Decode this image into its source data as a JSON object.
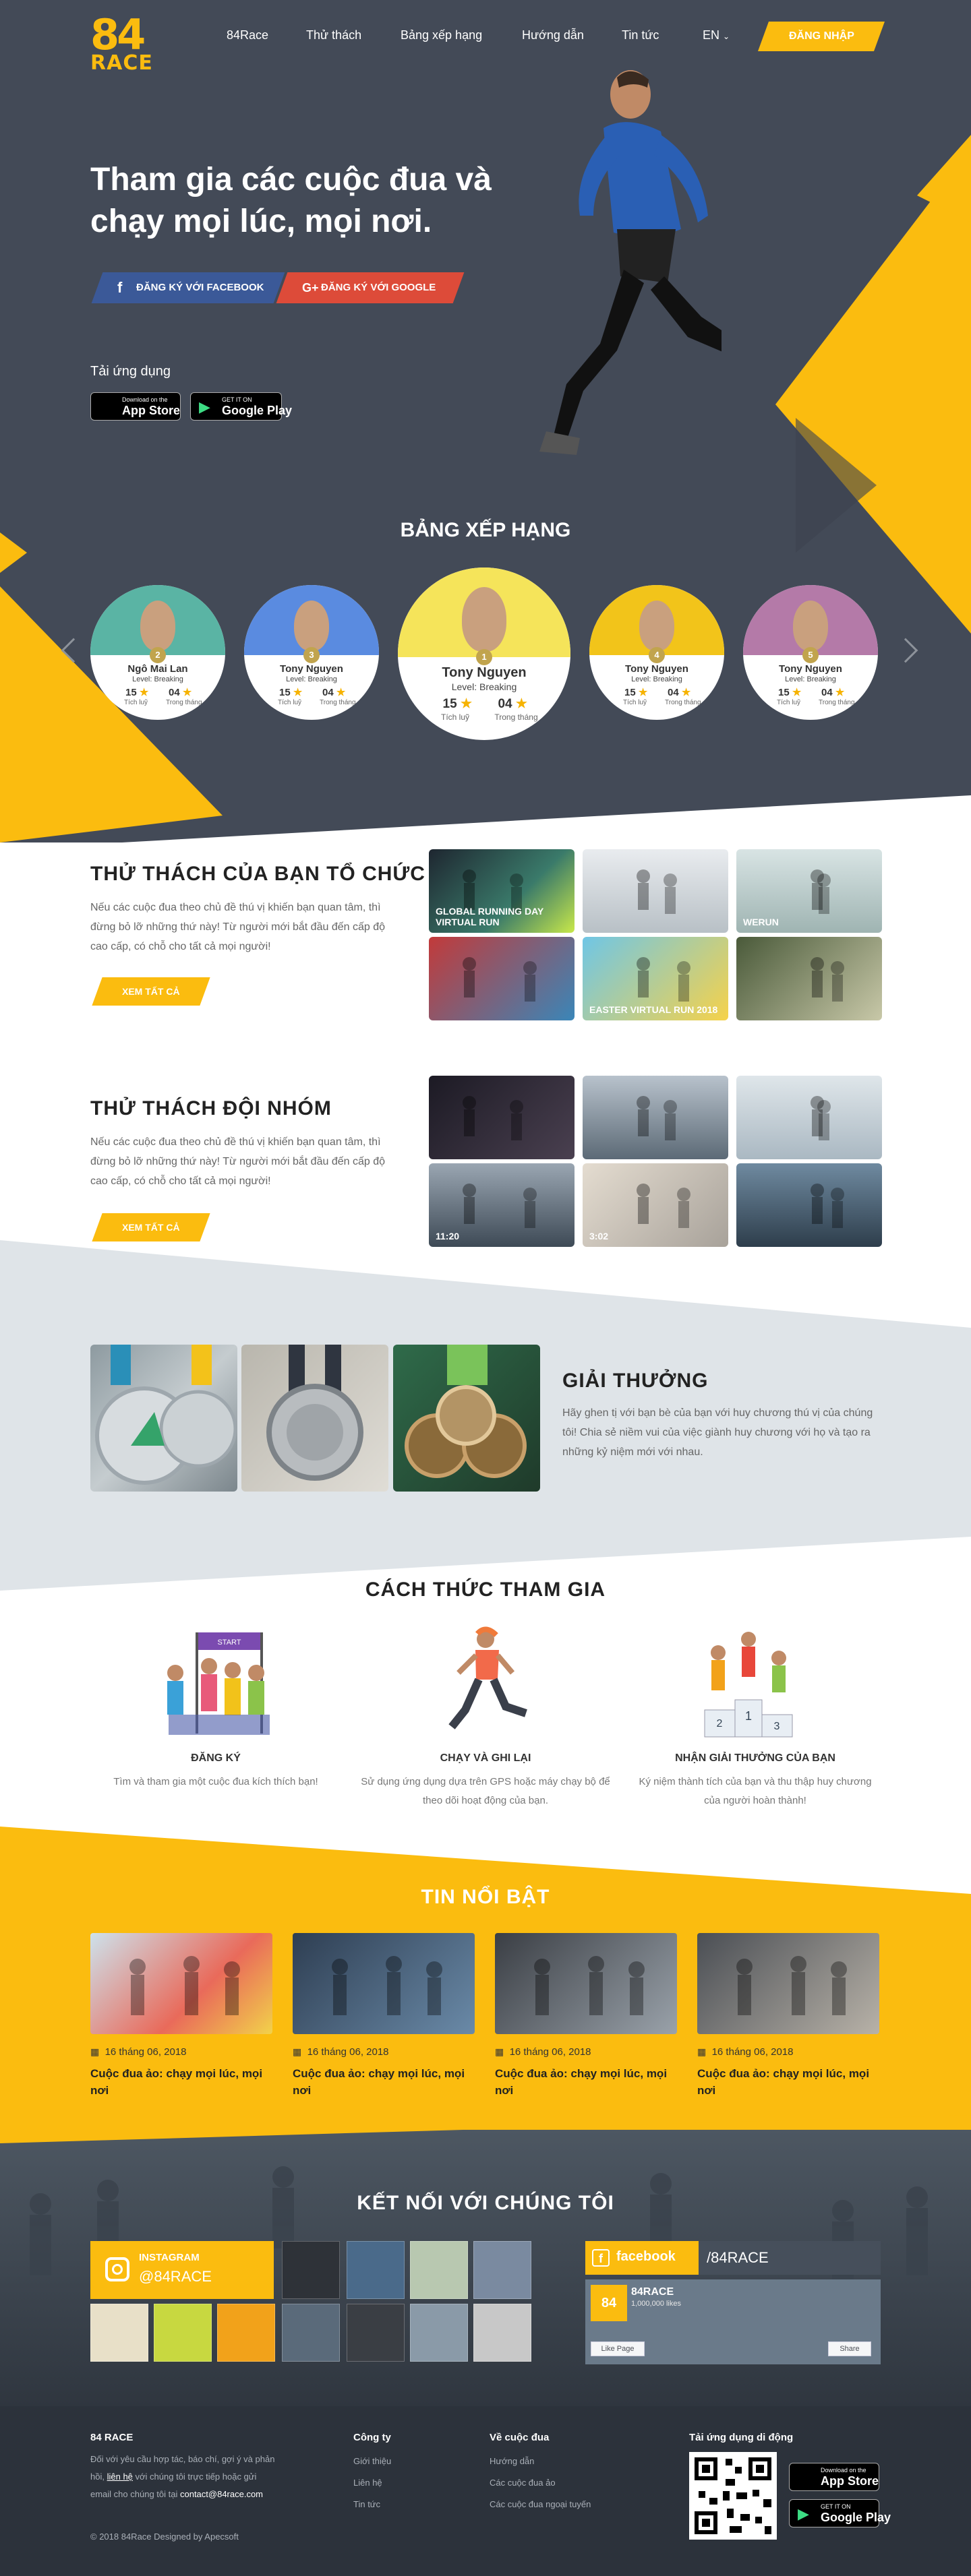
{
  "brand": {
    "logo_number": "84",
    "logo_word": "RACE"
  },
  "nav": {
    "items": [
      "84Race",
      "Thử thách",
      "Bảng xếp hạng",
      "Hướng dẫn",
      "Tin tức"
    ],
    "lang": "EN",
    "login": "ĐĂNG NHẬP"
  },
  "hero": {
    "title": "Tham gia các cuộc đua và chạy mọi lúc, mọi nơi.",
    "facebook_btn": "ĐĂNG KÝ VỚI FACEBOOK",
    "google_btn": "ĐĂNG KÝ VỚI GOOGLE",
    "apps_label": "Tải ứng dụng",
    "appstore_small": "Download on the",
    "appstore_big": "App Store",
    "googleplay_small": "GET IT ON",
    "googleplay_big": "Google Play"
  },
  "leaderboard": {
    "title": "BẢNG XẾP HẠNG",
    "cards": [
      {
        "rank": "2",
        "name": "Ngô Mai Lan",
        "level": "Level: Breaking",
        "total": "15",
        "month": "04",
        "total_label": "Tích luỹ",
        "month_label": "Trong tháng",
        "bg": "#5ab4a4"
      },
      {
        "rank": "3",
        "name": "Tony Nguyen",
        "level": "Level: Breaking",
        "total": "15",
        "month": "04",
        "total_label": "Tích luỹ",
        "month_label": "Trong tháng",
        "bg": "#5a8be0"
      },
      {
        "rank": "1",
        "name": "Tony Nguyen",
        "level": "Level: Breaking",
        "total": "15",
        "month": "04",
        "total_label": "Tích luỹ",
        "month_label": "Trong tháng",
        "bg": "#f5e45a"
      },
      {
        "rank": "4",
        "name": "Tony Nguyen",
        "level": "Level: Breaking",
        "total": "15",
        "month": "04",
        "total_label": "Tích luỹ",
        "month_label": "Trong tháng",
        "bg": "#f2c41a"
      },
      {
        "rank": "5",
        "name": "Tony Nguyen",
        "level": "Level: Breaking",
        "total": "15",
        "month": "04",
        "total_label": "Tích luỹ",
        "month_label": "Trong tháng",
        "bg": "#b47aa8"
      }
    ]
  },
  "organizer": {
    "title": "THỬ THÁCH CỦA BẠN TỔ CHỨC",
    "desc": "Nếu các cuộc đua theo chủ đề thú vị khiến bạn quan tâm, thì đừng bỏ lỡ những thứ này! Từ người mới bắt đầu đến cấp độ cao cấp, có chỗ cho tất cả mọi người!",
    "see_all": "XEM TẤT CẢ",
    "thumb_caps": [
      "GLOBAL RUNNING DAY VIRTUAL RUN",
      "",
      "WERUN",
      "",
      "EASTER VIRTUAL RUN 2018",
      ""
    ]
  },
  "team": {
    "title": "THỬ THÁCH ĐỘI NHÓM",
    "desc": "Nếu các cuộc đua theo chủ đề thú vị khiến bạn quan tâm, thì đừng bỏ lỡ những thứ này! Từ người mới bắt đầu đến cấp độ cao cấp, có chỗ cho tất cả mọi người!",
    "see_all": "XEM TẤT CẢ",
    "thumb_caps": [
      "",
      "",
      "",
      "11:20",
      "3:02",
      ""
    ]
  },
  "awards": {
    "title": "GIẢI THƯỞNG",
    "desc": "Hãy ghen tị với bạn bè của bạn với huy chương thú vị của chúng tôi! Chia sẻ niềm vui của việc giành huy chương với họ và tạo ra những kỷ niệm mới với nhau."
  },
  "how": {
    "title": "CÁCH THỨC THAM GIA",
    "steps": [
      {
        "title": "ĐĂNG KÝ",
        "desc": "Tìm và tham gia một cuộc đua kích thích bạn!",
        "sign": "START"
      },
      {
        "title": "CHẠY VÀ GHI LẠI",
        "desc": "Sử dụng ứng dụng dựa trên GPS hoặc máy chạy bộ để theo dõi hoạt động của bạn."
      },
      {
        "title": "NHẬN GIẢI THƯỞNG CỦA BẠN",
        "desc": "Ký niệm thành tích của bạn và thu thập huy chương của người hoàn thành!"
      }
    ]
  },
  "news": {
    "title": "TIN NỔI BẬT",
    "items": [
      {
        "date": "16 tháng 06, 2018",
        "title": "Cuộc đua ảo: chạy mọi lúc, mọi nơi"
      },
      {
        "date": "16 tháng 06, 2018",
        "title": "Cuộc đua ảo: chạy mọi lúc, mọi nơi"
      },
      {
        "date": "16 tháng 06, 2018",
        "title": "Cuộc đua ảo: chạy mọi lúc, mọi nơi"
      },
      {
        "date": "16 tháng 06, 2018",
        "title": "Cuộc đua ảo: chạy mọi lúc, mọi nơi"
      }
    ]
  },
  "connect": {
    "title": "KẾT NỐI VỚI CHÚNG TÔI",
    "instagram_label": "INSTAGRAM",
    "instagram_handle": "@84RACE",
    "facebook_label": "facebook",
    "facebook_handle": "/84RACE",
    "fb_page_name": "84RACE",
    "fb_likes": "1,000,000 likes",
    "fb_like_btn": "Like Page",
    "fb_share_btn": "Share"
  },
  "footer": {
    "about_title": "84 RACE",
    "about_text_1": "Đối với yêu cầu hợp tác, báo chí, gợi ý và phản hồi,",
    "about_link": "liên hệ",
    "about_text_2": "với chúng tôi trực tiếp hoặc gửi email cho chúng tôi tại",
    "email": "contact@84race.com",
    "company_title": "Công ty",
    "company_links": [
      "Giới thiệu",
      "Liên hệ",
      "Tin tức"
    ],
    "race_title": "Về cuộc đua",
    "race_links": [
      "Hướng dẫn",
      "Các cuộc đua ảo",
      "Các cuộc đua ngoại tuyến"
    ],
    "app_title": "Tải ứng dụng di động",
    "copyright": "© 2018 84Race Designed by Apecsoft"
  },
  "colors": {
    "accent": "#fbbc0f",
    "dark": "#434a57",
    "facebook": "#3b5998",
    "google": "#dd4b39",
    "footer": "#2c323b"
  }
}
